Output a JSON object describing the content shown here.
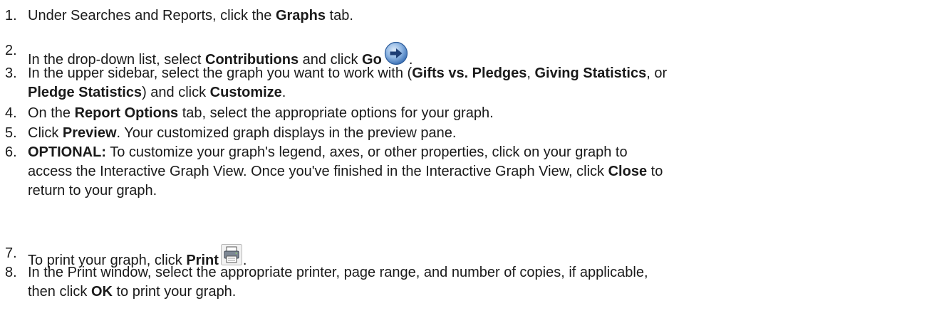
{
  "steps": [
    {
      "num": "1.",
      "parts": [
        {
          "t": "Under Searches and Reports, click the "
        },
        {
          "b": "Graphs"
        },
        {
          "t": " tab."
        }
      ]
    },
    {
      "num": "2.",
      "parts": [
        {
          "t": "In the drop-down list, select "
        },
        {
          "b": "Contributions"
        },
        {
          "t": " and click "
        },
        {
          "b": "Go"
        },
        {
          "icon": "go-arrow-icon"
        },
        {
          "t": "."
        }
      ]
    },
    {
      "num": "3.",
      "parts": [
        {
          "t": "In the upper sidebar, select the graph you want to work with ("
        },
        {
          "b": "Gifts vs. Pledges"
        },
        {
          "t": ", "
        },
        {
          "b": "Giving Statistics"
        },
        {
          "t": ", or "
        },
        {
          "br": true
        },
        {
          "b": "Pledge Statistics"
        },
        {
          "t": ") and click "
        },
        {
          "b": "Customize"
        },
        {
          "t": "."
        }
      ]
    },
    {
      "num": "4.",
      "parts": [
        {
          "t": "On the "
        },
        {
          "b": "Report Options"
        },
        {
          "t": " tab, select the appropriate options for your graph."
        }
      ]
    },
    {
      "num": "5.",
      "parts": [
        {
          "t": "Click "
        },
        {
          "b": "Preview"
        },
        {
          "t": ". Your customized graph displays in the preview pane."
        }
      ]
    },
    {
      "num": "6.",
      "parts": [
        {
          "b": "OPTIONAL:"
        },
        {
          "t": " To customize your graph's legend, axes, or other properties, click on your graph to "
        },
        {
          "br": true
        },
        {
          "t": "access the Interactive Graph View. Once you've finished in the Interactive Graph View, click "
        },
        {
          "b": "Close"
        },
        {
          "t": " to "
        },
        {
          "br": true
        },
        {
          "t": "return to your graph."
        }
      ]
    },
    {
      "num": "7.",
      "parts": [
        {
          "t": "To print your graph, click "
        },
        {
          "b": "Print"
        },
        {
          "icon": "printer-icon"
        },
        {
          "t": "."
        }
      ]
    },
    {
      "num": "8.",
      "parts": [
        {
          "t": "In the Print window, select the appropriate printer, page range, and number of copies, if applicable, "
        },
        {
          "br": true
        },
        {
          "t": "then click "
        },
        {
          "b": "OK"
        },
        {
          "t": " to print your graph."
        }
      ]
    }
  ]
}
